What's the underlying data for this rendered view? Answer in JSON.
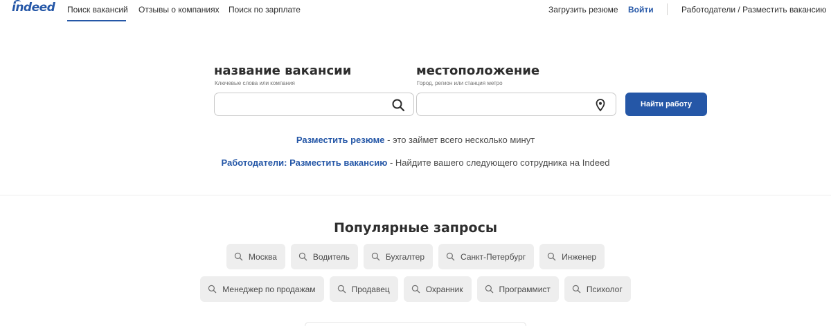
{
  "header": {
    "logo": "indeed",
    "nav": [
      "Поиск вакансий",
      "Отзывы о компаниях",
      "Поиск по зарплате"
    ],
    "upload_resume": "Загрузить резюме",
    "login": "Войти",
    "employers": "Работодатели / Разместить вакансию"
  },
  "search": {
    "what_label": "название вакансии",
    "what_hint": "Ключевые слова или компания",
    "what_value": "",
    "where_label": "местоположение",
    "where_hint": "Город, регион или станция метро",
    "where_value": "",
    "button": "Найти работу"
  },
  "promo": {
    "resume_link": "Разместить резюме",
    "resume_text": " - это займет всего несколько минут",
    "employer_link": "Работодатели: Разместить вакансию",
    "employer_text": " - Найдите вашего следующего сотрудника на Indeed"
  },
  "popular": {
    "title": "Популярные запросы",
    "row1": [
      "Москва",
      "Водитель",
      "Бухгалтер",
      "Санкт-Петербург",
      "Инженер"
    ],
    "row2": [
      "Менеджер по продажам",
      "Продавец",
      "Охранник",
      "Программист",
      "Психолог"
    ]
  },
  "colors": {
    "brand": "#2557a7",
    "chip_bg": "#eeeeee"
  }
}
